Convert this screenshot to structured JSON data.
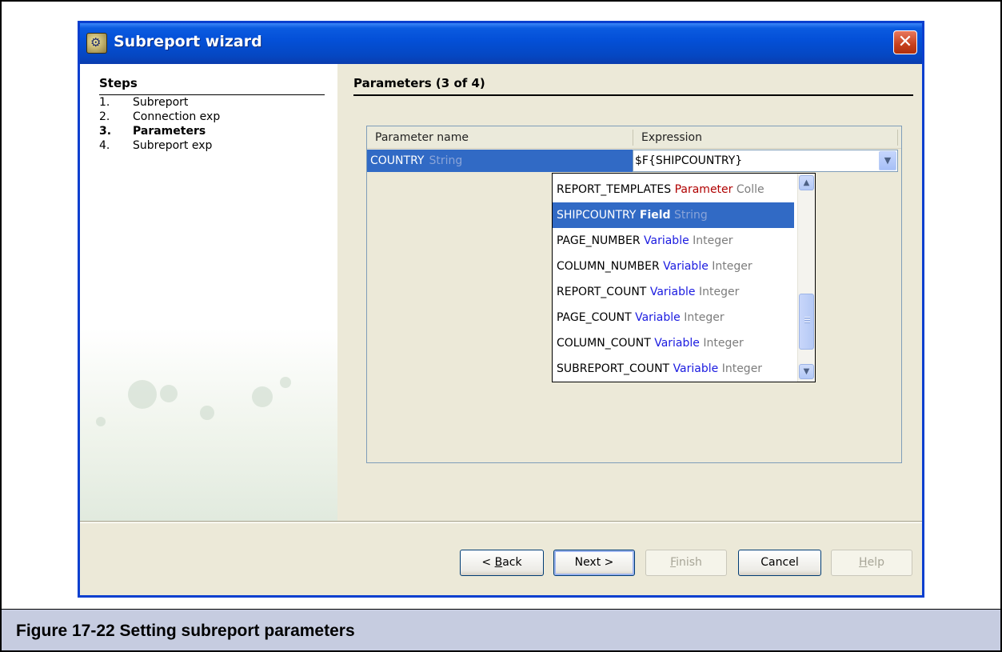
{
  "window": {
    "title": "Subreport wizard",
    "close_glyph": "✕"
  },
  "steps": {
    "title": "Steps",
    "items": [
      {
        "num": "1.",
        "label": "Subreport"
      },
      {
        "num": "2.",
        "label": "Connection exp"
      },
      {
        "num": "3.",
        "label": "Parameters"
      },
      {
        "num": "4.",
        "label": "Subreport exp"
      }
    ],
    "active_index": 2
  },
  "page": {
    "title": "Parameters (3 of 4)"
  },
  "table": {
    "columns": [
      "Parameter name",
      "Expression"
    ],
    "row": {
      "name": "COUNTRY",
      "type": "String",
      "expression": "$F{SHIPCOUNTRY}"
    }
  },
  "dropdown": {
    "items": [
      {
        "name": "REPORT_TEMPLATES",
        "kind": "Parameter",
        "dtype": "Colle",
        "selected": false
      },
      {
        "name": "SHIPCOUNTRY",
        "kind": "Field",
        "dtype": "String",
        "selected": true
      },
      {
        "name": "PAGE_NUMBER",
        "kind": "Variable",
        "dtype": "Integer",
        "selected": false
      },
      {
        "name": "COLUMN_NUMBER",
        "kind": "Variable",
        "dtype": "Integer",
        "selected": false
      },
      {
        "name": "REPORT_COUNT",
        "kind": "Variable",
        "dtype": "Integer",
        "selected": false
      },
      {
        "name": "PAGE_COUNT",
        "kind": "Variable",
        "dtype": "Integer",
        "selected": false
      },
      {
        "name": "COLUMN_COUNT",
        "kind": "Variable",
        "dtype": "Integer",
        "selected": false
      },
      {
        "name": "SUBREPORT_COUNT",
        "kind": "Variable",
        "dtype": "Integer",
        "selected": false
      }
    ]
  },
  "buttons": {
    "back": {
      "pre": "< ",
      "mnemonic": "B",
      "post": "ack"
    },
    "next": {
      "pre": "",
      "mnemonic": "",
      "post": "Next >"
    },
    "finish": {
      "pre": "",
      "mnemonic": "F",
      "post": "inish"
    },
    "cancel": {
      "pre": "",
      "mnemonic": "",
      "post": "Cancel"
    },
    "help": {
      "pre": "",
      "mnemonic": "H",
      "post": "elp"
    }
  },
  "caption": {
    "text": "Figure 17-22  Setting subreport parameters"
  },
  "colors": {
    "titlebar": "#0450d8",
    "selection": "#316ac5",
    "parameter_kind": "#b00000",
    "variable_kind": "#1a1ae0",
    "caption_bg": "#c6cce0"
  },
  "icons": {
    "app": "subreport-wizard-icon",
    "close": "close-icon",
    "combo": "chevron-down-icon",
    "scroll_up": "chevron-up-icon",
    "scroll_down": "chevron-down-icon"
  }
}
